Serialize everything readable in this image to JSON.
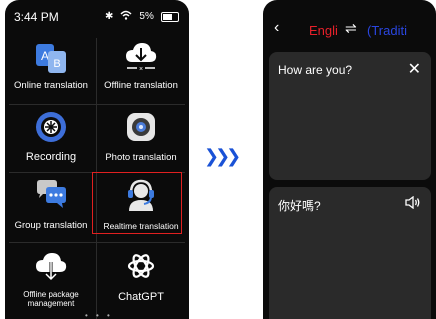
{
  "status": {
    "time": "3:44 PM",
    "battery": "5%"
  },
  "menu": {
    "items": [
      {
        "label": "Online translation",
        "icon": "translate-icon"
      },
      {
        "label": "Offline translation",
        "icon": "cloud-offline-icon"
      },
      {
        "label": "Recording",
        "icon": "record-icon"
      },
      {
        "label": "Photo translation",
        "icon": "camera-icon"
      },
      {
        "label": "Group translation",
        "icon": "chat-icon"
      },
      {
        "label": "Realtime translation",
        "icon": "headset-icon",
        "highlighted": true
      },
      {
        "label": "Offline package\nmanagement",
        "icon": "cloud-download-icon"
      },
      {
        "label": "ChatGPT",
        "icon": "chatgpt-icon"
      }
    ]
  },
  "translate": {
    "source_lang": "Engli",
    "target_lang": "(Traditi",
    "input_text": "How are you?",
    "output_text": "你好嗎?"
  },
  "colors": {
    "highlight": "#e02020",
    "source": "#e8202a",
    "target": "#2a46e0",
    "arrow": "#1a52d6"
  }
}
